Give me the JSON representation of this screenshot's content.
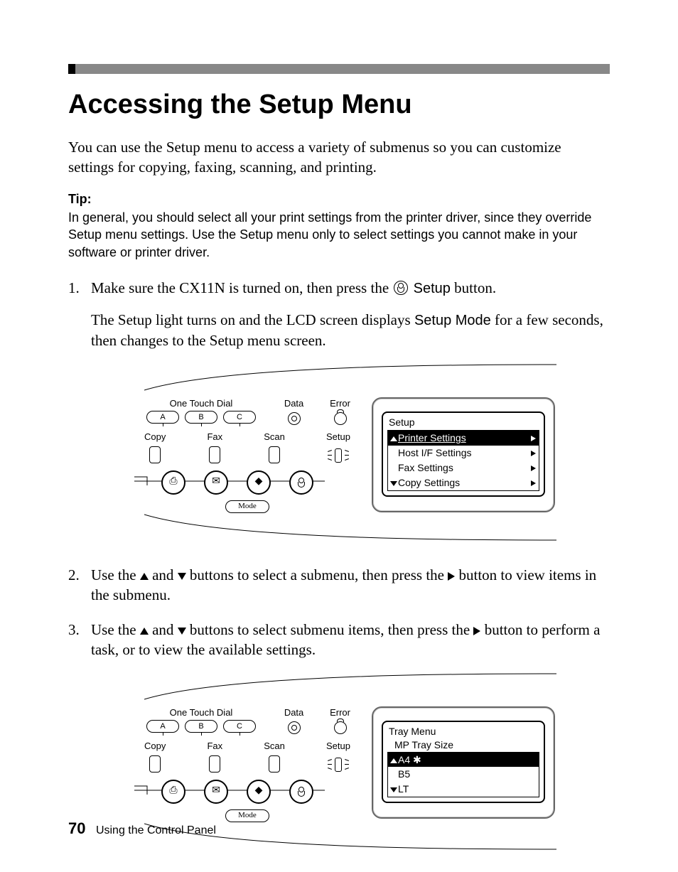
{
  "header": {
    "title": "Accessing the Setup Menu"
  },
  "intro": "You can use the Setup menu to access a variety of submenus so you can customize settings for copying, faxing, scanning, and printing.",
  "tip": {
    "label": "Tip:",
    "text": "In general, you should select all your print settings from the printer driver, since they override Setup menu settings. Use the Setup menu only to select settings you cannot make in your software or printer driver."
  },
  "steps": {
    "s1_a": "Make sure the CX11N is turned on, then press the ",
    "s1_b_button": "Setup",
    "s1_c": " button.",
    "s1_sub_a": "The Setup light turns on and the LCD screen displays ",
    "s1_sub_b": "Setup Mode",
    "s1_sub_c": " for a few seconds, then changes to the Setup menu screen.",
    "s2_a": "Use the ",
    "s2_b": " and ",
    "s2_c": " buttons to select a submenu, then press the ",
    "s2_d": " button to view items in the submenu.",
    "s3_a": "Use the ",
    "s3_b": " and ",
    "s3_c": " buttons to select submenu items, then press the ",
    "s3_d": " button to perform a task, or to view the available settings."
  },
  "panel": {
    "one_touch_dial": "One Touch Dial",
    "a": "A",
    "b": "B",
    "c": "C",
    "data": "Data",
    "error": "Error",
    "copy": "Copy",
    "fax": "Fax",
    "scan": "Scan",
    "setup": "Setup",
    "mode": "Mode"
  },
  "lcd1": {
    "title": "Setup",
    "items": [
      "Printer Settings",
      "Host I/F Settings",
      "Fax Settings",
      "Copy Settings"
    ]
  },
  "lcd2": {
    "title": "Tray Menu",
    "sub": "MP Tray Size",
    "items": [
      "A4  ✱",
      "B5",
      "LT"
    ]
  },
  "footer": {
    "page": "70",
    "section": "Using the Control Panel"
  }
}
